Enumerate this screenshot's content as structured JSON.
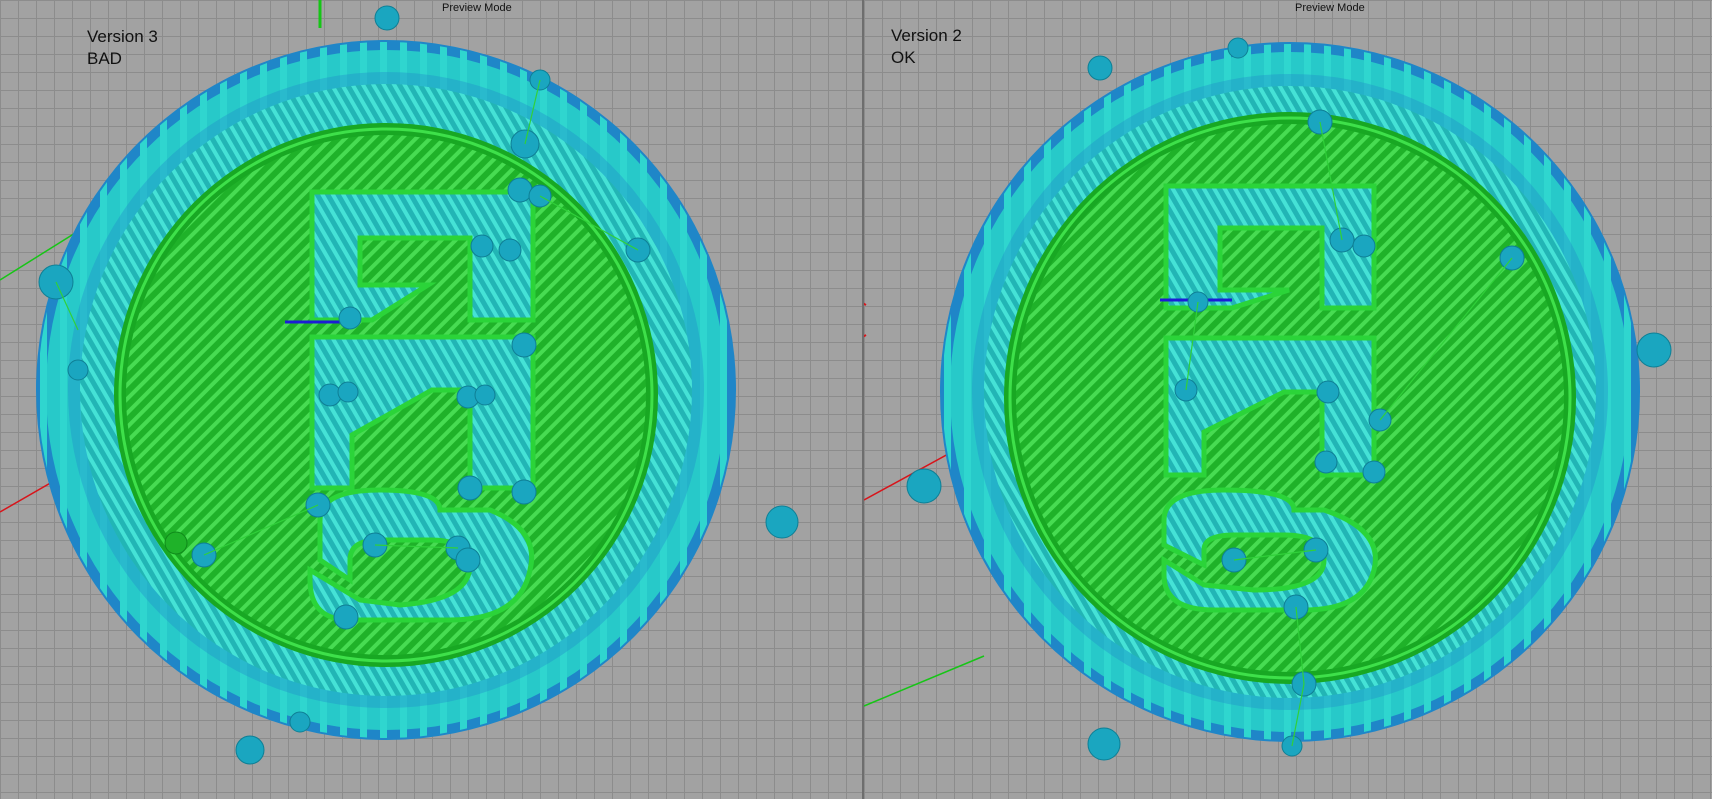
{
  "colors": {
    "skirt_outer": "#1f86c8",
    "skirt_inner": "#27c9c9",
    "fill_teal": "#3dd6c6",
    "hatch_teal": "#1aa7a7",
    "green": "#22c02e",
    "green_light": "#3fe04a",
    "green_dark": "#0f8a1a",
    "axis_x": "#d8141a",
    "axis_y": "#16c516",
    "axis_z": "#1c1cd6"
  },
  "left_view": {
    "mode_label": "Preview Mode",
    "version": "Version 3",
    "status": "BAD"
  },
  "right_view": {
    "mode_label": "Preview Mode",
    "version": "Version 2",
    "status": "OK"
  }
}
